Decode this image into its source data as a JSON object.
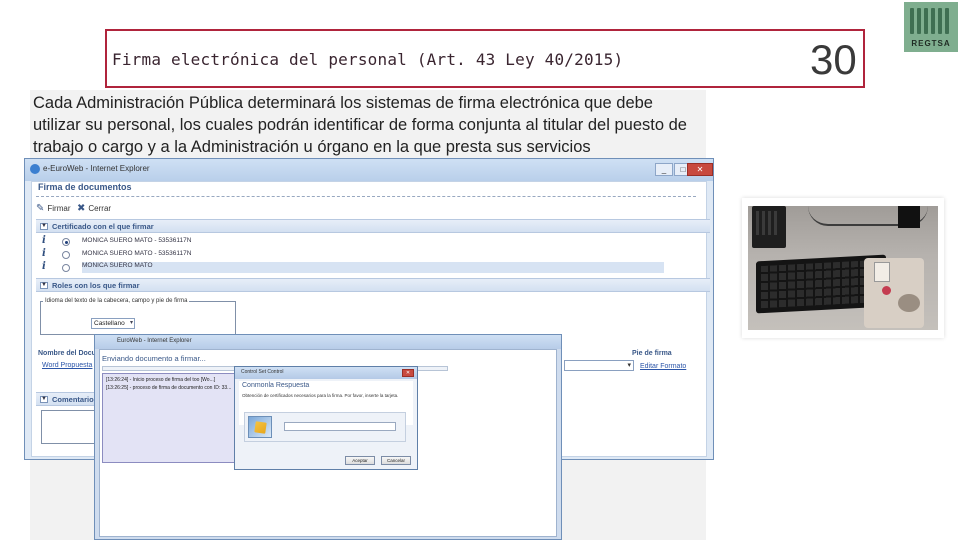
{
  "slide": {
    "title": "Firma electrónica del personal (Art. 43 Ley 40/2015)",
    "number": "30",
    "logo_text": "REGTSA",
    "description": "Cada Administración Pública determinará los sistemas de firma electrónica que debe utilizar su personal, los cuales podrán identificar de forma conjunta al titular del puesto de trabajo o cargo y a la Administración u órgano en la que presta sus servicios",
    "accent_color": "#b0243c"
  },
  "ie_window": {
    "title": "e-EuroWeb - Internet Explorer",
    "header": "Firma de documentos",
    "toolbar": {
      "sign_label": "Firmar",
      "close_label": "Cerrar"
    },
    "section_cert": "Certificado con el que firmar",
    "certs": [
      "MONICA SUERO MATO - 53536117N",
      "MONICA SUERO MATO - 53536117N",
      "MONICA SUERO MATO"
    ],
    "section_roles": "Roles con los que firmar",
    "language_legend": "Idioma del texto de la cabecera, campo y pie de firma",
    "language_value": "Castellano",
    "col_doc": "Nombre del Documento",
    "doc_link": "Word Propuesta",
    "col_footer": "Pie de firma",
    "footer_link": "Editar Formato",
    "section_comment": "Comentario"
  },
  "send_window": {
    "title": "EuroWeb - Internet Explorer",
    "heading": "Enviando documento a firmar...",
    "log": [
      "[13:26:24] - Inicio proceso de firma del too [Wo...]",
      "[13:26:25] - proceso de firma de documento con ID: 33..."
    ]
  },
  "dialog": {
    "title": "Control Set Control",
    "heading": "Conmonla Respuesta",
    "message": "Obtención de certificados necesarios para la firma. Por favor, inserte la tarjeta.",
    "accept_label": "Aceptar",
    "cancel_label": "Cancelar"
  }
}
